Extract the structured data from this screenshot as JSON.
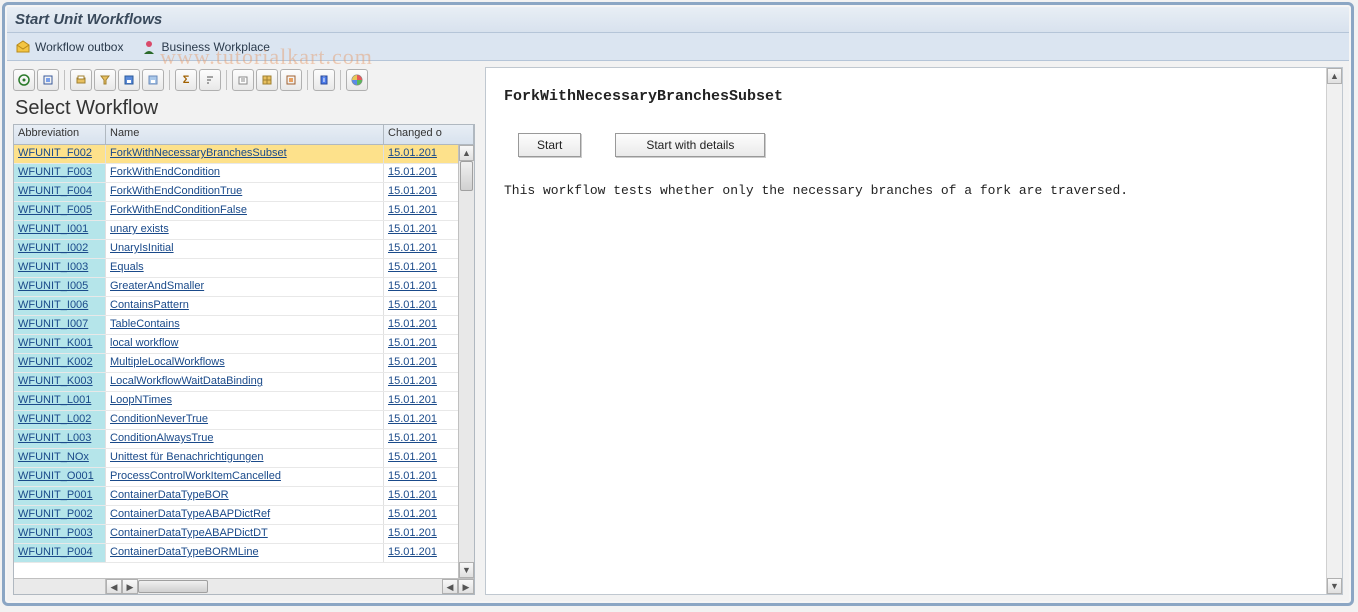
{
  "title": "Start Unit Workflows",
  "menu": {
    "outbox": "Workflow outbox",
    "workplace": "Business Workplace"
  },
  "watermark": "www.tutorialkart.com",
  "left": {
    "heading": "Select Workflow",
    "columns": {
      "abbrev": "Abbreviation",
      "name": "Name",
      "changed": "Changed o"
    },
    "rows": [
      {
        "abbrev": "WFUNIT_F002",
        "name": "ForkWithNecessaryBranchesSubset",
        "changed": "15.01.201",
        "selected": true
      },
      {
        "abbrev": "WFUNIT_F003",
        "name": "ForkWithEndCondition",
        "changed": "15.01.201"
      },
      {
        "abbrev": "WFUNIT_F004",
        "name": "ForkWithEndConditionTrue",
        "changed": "15.01.201"
      },
      {
        "abbrev": "WFUNIT_F005",
        "name": "ForkWithEndConditionFalse",
        "changed": "15.01.201"
      },
      {
        "abbrev": "WFUNIT_I001",
        "name": "unary exists",
        "changed": "15.01.201"
      },
      {
        "abbrev": "WFUNIT_I002",
        "name": "UnaryIsInitial",
        "changed": "15.01.201"
      },
      {
        "abbrev": "WFUNIT_I003",
        "name": "Equals",
        "changed": "15.01.201"
      },
      {
        "abbrev": "WFUNIT_I005",
        "name": "GreaterAndSmaller",
        "changed": "15.01.201"
      },
      {
        "abbrev": "WFUNIT_I006",
        "name": "ContainsPattern",
        "changed": "15.01.201"
      },
      {
        "abbrev": "WFUNIT_I007",
        "name": "TableContains",
        "changed": "15.01.201"
      },
      {
        "abbrev": "WFUNIT_K001",
        "name": "local workflow",
        "changed": "15.01.201"
      },
      {
        "abbrev": "WFUNIT_K002",
        "name": "MultipleLocalWorkflows",
        "changed": "15.01.201"
      },
      {
        "abbrev": "WFUNIT_K003",
        "name": "LocalWorkflowWaitDataBinding",
        "changed": "15.01.201"
      },
      {
        "abbrev": "WFUNIT_L001",
        "name": "LoopNTimes",
        "changed": "15.01.201"
      },
      {
        "abbrev": "WFUNIT_L002",
        "name": "ConditionNeverTrue",
        "changed": "15.01.201"
      },
      {
        "abbrev": "WFUNIT_L003",
        "name": "ConditionAlwaysTrue",
        "changed": "15.01.201"
      },
      {
        "abbrev": "WFUNIT_NOx",
        "name": "Unittest für Benachrichtigungen",
        "changed": "15.01.201"
      },
      {
        "abbrev": "WFUNIT_O001",
        "name": "ProcessControlWorkItemCancelled",
        "changed": "15.01.201"
      },
      {
        "abbrev": "WFUNIT_P001",
        "name": "ContainerDataTypeBOR",
        "changed": "15.01.201"
      },
      {
        "abbrev": "WFUNIT_P002",
        "name": "ContainerDataTypeABAPDictRef",
        "changed": "15.01.201"
      },
      {
        "abbrev": "WFUNIT_P003",
        "name": "ContainerDataTypeABAPDictDT",
        "changed": "15.01.201"
      },
      {
        "abbrev": "WFUNIT_P004",
        "name": "ContainerDataTypeBORMLine",
        "changed": "15.01.201"
      }
    ]
  },
  "toolbar": {
    "icons": [
      "detail-icon",
      "find-icon",
      "print-icon",
      "filter-icon",
      "save-icon",
      "save2-icon",
      "sum-icon",
      "sort-icon",
      "export-icon",
      "layout-icon",
      "select-icon",
      "info-icon",
      "chart-icon"
    ]
  },
  "detail": {
    "title": "ForkWithNecessaryBranchesSubset",
    "start": "Start",
    "start_details": "Start with details",
    "description": "This workflow tests whether only the necessary branches of a fork are traversed."
  }
}
